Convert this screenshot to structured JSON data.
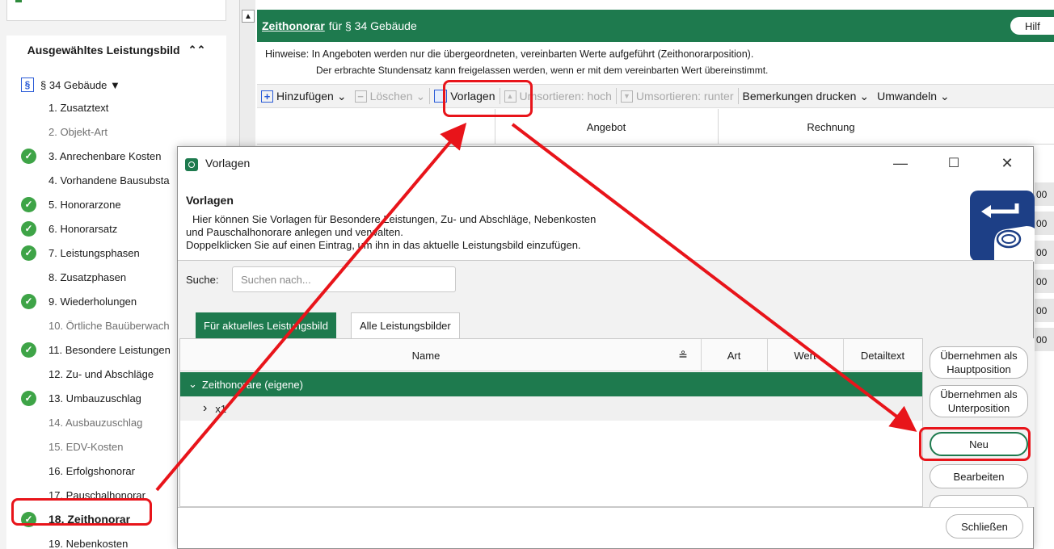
{
  "sidebar": {
    "header": "Ausgewähltes Leistungsbild",
    "collapse_glyph": "‸",
    "root_icon": "§",
    "root_label": "§ 34 Gebäude ▼",
    "items": [
      {
        "label": "1. Zusatztext",
        "status": "none"
      },
      {
        "label": "2. Objekt-Art",
        "status": "inactive"
      },
      {
        "label": "3. Anrechenbare Kosten",
        "status": "done"
      },
      {
        "label": "4. Vorhandene Bausubsta",
        "status": "none"
      },
      {
        "label": "5. Honorarzone",
        "status": "done"
      },
      {
        "label": "6. Honorarsatz",
        "status": "done"
      },
      {
        "label": "7. Leistungsphasen",
        "status": "done"
      },
      {
        "label": "8. Zusatzphasen",
        "status": "none"
      },
      {
        "label": "9. Wiederholungen",
        "status": "done"
      },
      {
        "label": "10. Örtliche Bauüberwach",
        "status": "inactive"
      },
      {
        "label": "11. Besondere Leistungen",
        "status": "done"
      },
      {
        "label": "12. Zu- und Abschläge",
        "status": "none"
      },
      {
        "label": "13. Umbauzuschlag",
        "status": "done"
      },
      {
        "label": "14. Ausbauzuschlag",
        "status": "inactive"
      },
      {
        "label": "15. EDV-Kosten",
        "status": "inactive"
      },
      {
        "label": "16. Erfolgshonorar",
        "status": "none"
      },
      {
        "label": "17. Pauschalhonorar",
        "status": "none"
      },
      {
        "label": "18. Zeithonorar",
        "status": "active"
      },
      {
        "label": "19. Nebenkosten",
        "status": "none"
      }
    ]
  },
  "main": {
    "title_link": "Zeithonorar",
    "title_rest": "für § 34 Gebäude",
    "help_label": "Hilf",
    "hint_line1": "Hinweise: In Angeboten werden nur die übergeordneten, vereinbarten Werte aufgeführt (Zeithonorarposition).",
    "hint_line2": "Der erbrachte Stundensatz kann freigelassen werden, wenn er mit dem vereinbarten Wert übereinstimmt.",
    "toolbar": {
      "add": "Hinzufügen",
      "delete": "Löschen",
      "templates": "Vorlagen",
      "sort_up": "Umsortieren: hoch",
      "sort_down": "Umsortieren: runter",
      "print_remarks": "Bemerkungen drucken",
      "convert": "Umwandeln",
      "dropdown_glyph": "⌄"
    },
    "columns": {
      "angebot": "Angebot",
      "rechnung": "Rechnung"
    },
    "right_numbers": [
      "00",
      "00",
      "00",
      "00",
      "00",
      "00"
    ]
  },
  "dialog": {
    "window_title": "Vorlagen",
    "minimize": "—",
    "maximize": "☐",
    "close": "✕",
    "heading": "Vorlagen",
    "desc_line1": "Hier können Sie Vorlagen für Besondere Leistungen, Zu- und Abschläge, Nebenkosten",
    "desc_line2": "und Pauschalhonorare anlegen und verwalten.",
    "desc_line3": "Doppelklicken Sie auf einen Eintrag, um ihn in das aktuelle Leistungsbild einzufügen.",
    "search_label": "Suche:",
    "search_placeholder": "Suchen nach...",
    "tabs": {
      "current": "Für aktuelles Leistungsbild",
      "all": "Alle Leistungsbilder"
    },
    "grid_headers": {
      "name": "Name",
      "sort_glyph": "≗",
      "art": "Art",
      "wert": "Wert",
      "detailtext": "Detailtext"
    },
    "rows": [
      {
        "prefix": "⌄",
        "name": "Zeithonorare (eigene)"
      },
      {
        "prefix": "›",
        "name": "x1"
      }
    ],
    "buttons": {
      "take_main": "Übernehmen als Hauptposition",
      "take_sub": "Übernehmen als Unterposition",
      "new": "Neu",
      "edit": "Bearbeiten",
      "close": "Schließen"
    }
  },
  "colors": {
    "brand_green": "#1e7a4e",
    "check_green": "#3ea447",
    "highlight_red": "#e8141a"
  }
}
